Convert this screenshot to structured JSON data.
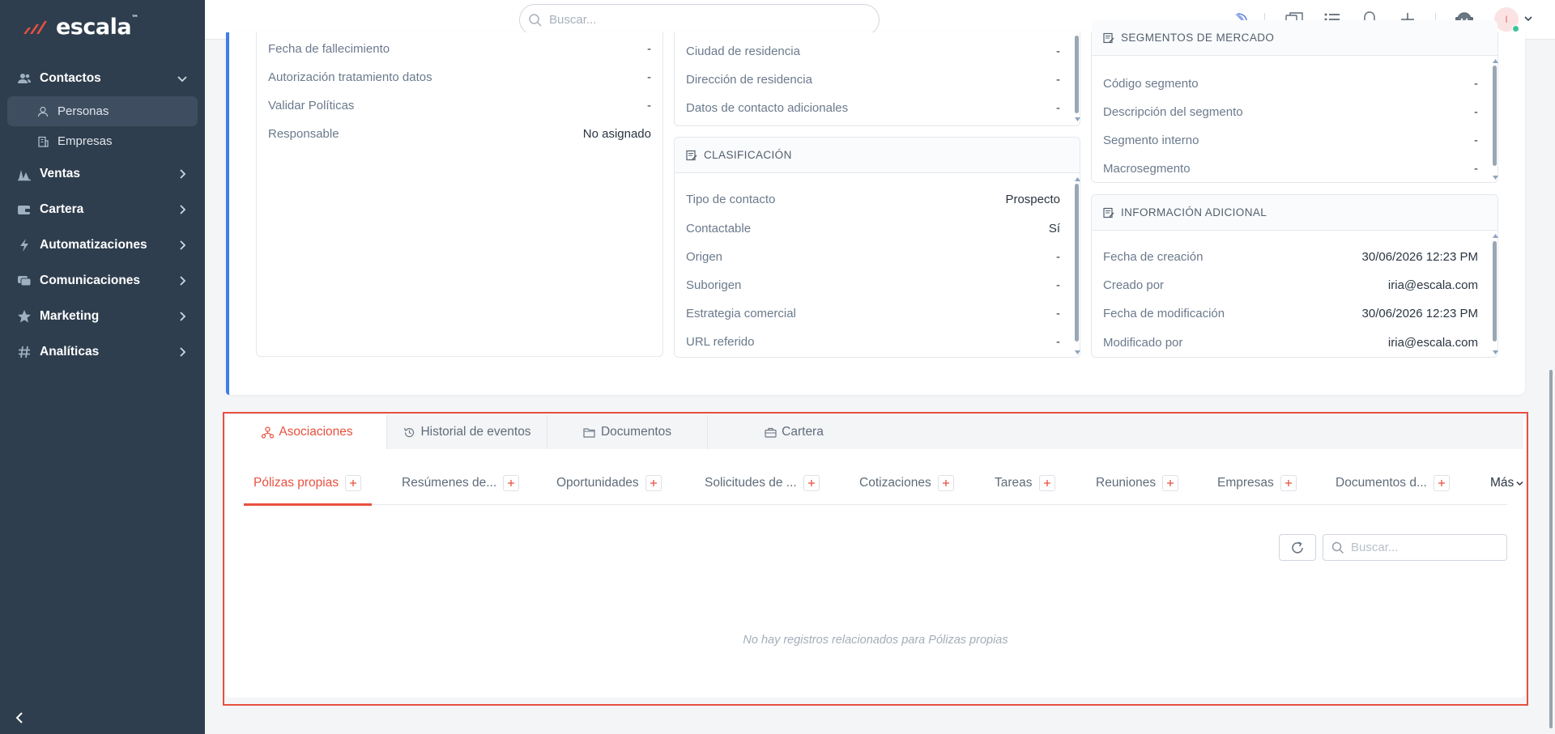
{
  "app": {
    "logo_text": "escala",
    "logo_tm": "™"
  },
  "sidebar": {
    "items": [
      {
        "label": "Contactos",
        "icon": "users-icon",
        "expanded": true
      },
      {
        "label": "Ventas",
        "icon": "chart-icon"
      },
      {
        "label": "Cartera",
        "icon": "wallet-icon"
      },
      {
        "label": "Automatizaciones",
        "icon": "bolt-icon"
      },
      {
        "label": "Comunicaciones",
        "icon": "chat-icon"
      },
      {
        "label": "Marketing",
        "icon": "star-icon"
      },
      {
        "label": "Analíticas",
        "icon": "hash-icon"
      }
    ],
    "sub_items": [
      {
        "label": "Personas",
        "icon": "person-icon",
        "active": true
      },
      {
        "label": "Empresas",
        "icon": "building-icon"
      }
    ]
  },
  "topbar": {
    "search_placeholder": "Buscar...",
    "avatar_initial": "I"
  },
  "left_fields": [
    {
      "label": "Fecha de fallecimiento",
      "value": "-"
    },
    {
      "label": "Autorización tratamiento datos",
      "value": "-"
    },
    {
      "label": "Validar Políticas",
      "value": "-"
    },
    {
      "label": "Responsable",
      "value": "No asignado"
    }
  ],
  "residence_fields": [
    {
      "label": "Ciudad de residencia",
      "value": "-"
    },
    {
      "label": "Dirección de residencia",
      "value": "-"
    },
    {
      "label": "Datos de contacto adicionales",
      "value": "-"
    }
  ],
  "clasificacion": {
    "title": "CLASIFICACIÓN",
    "fields": [
      {
        "label": "Tipo de contacto",
        "value": "Prospecto"
      },
      {
        "label": "Contactable",
        "value": "Sí"
      },
      {
        "label": "Origen",
        "value": "-"
      },
      {
        "label": "Suborigen",
        "value": "-"
      },
      {
        "label": "Estrategia comercial",
        "value": "-"
      },
      {
        "label": "URL referido",
        "value": "-"
      }
    ]
  },
  "segmentos": {
    "title": "SEGMENTOS DE MERCADO",
    "fields": [
      {
        "label": "Código segmento",
        "value": "-"
      },
      {
        "label": "Descripción del segmento",
        "value": "-"
      },
      {
        "label": "Segmento interno",
        "value": "-"
      },
      {
        "label": "Macrosegmento",
        "value": "-"
      }
    ]
  },
  "info_adicional": {
    "title": "INFORMACIÓN ADICIONAL",
    "fields": [
      {
        "label": "Fecha de creación",
        "value": "30/06/2026 12:23 PM"
      },
      {
        "label": "Creado por",
        "value": "iria@escala.com"
      },
      {
        "label": "Fecha de modificación",
        "value": "30/06/2026 12:23 PM"
      },
      {
        "label": "Modificado por",
        "value": "iria@escala.com"
      }
    ]
  },
  "main_tabs": [
    {
      "label": "Asociaciones",
      "icon": "network-icon",
      "active": true
    },
    {
      "label": "Historial de eventos",
      "icon": "history-icon"
    },
    {
      "label": "Documentos",
      "icon": "folder-icon"
    },
    {
      "label": "Cartera",
      "icon": "briefcase-icon"
    }
  ],
  "sub_tabs": [
    {
      "label": "Pólizas propias",
      "active": true
    },
    {
      "label": "Resúmenes de..."
    },
    {
      "label": "Oportunidades"
    },
    {
      "label": "Solicitudes de ..."
    },
    {
      "label": "Cotizaciones"
    },
    {
      "label": "Tareas"
    },
    {
      "label": "Reuniones"
    },
    {
      "label": "Empresas"
    },
    {
      "label": "Documentos d..."
    }
  ],
  "more_label": "Más",
  "inner_search_placeholder": "Buscar...",
  "empty_message": "No hay registros relacionados para Pólizas propias",
  "colors": {
    "accent": "#e8503f",
    "sidebar_bg": "#2f3e4e",
    "blue_accent": "#3f7ee8"
  }
}
